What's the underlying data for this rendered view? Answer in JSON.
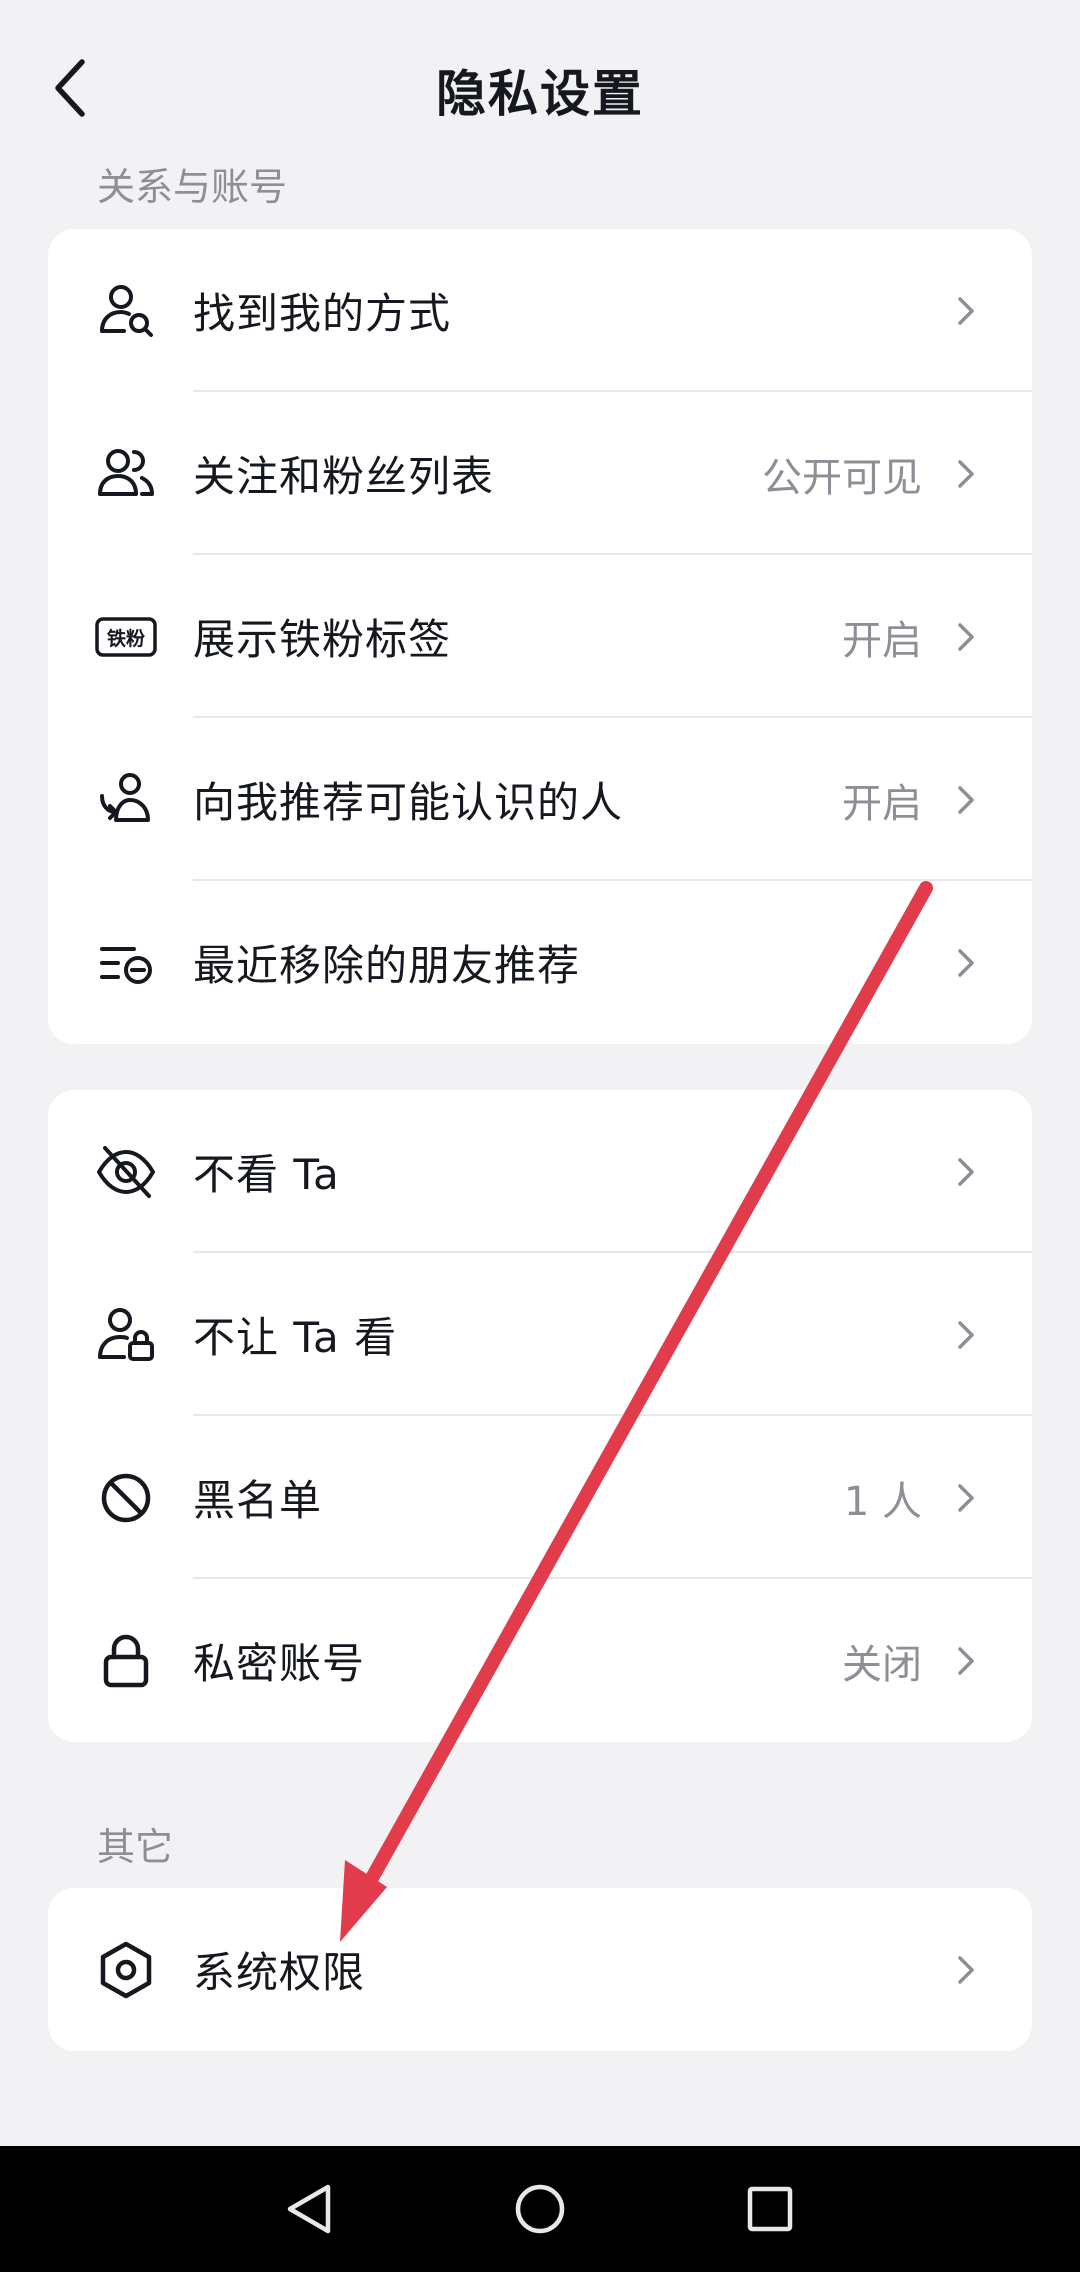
{
  "header": {
    "title": "隐私设置"
  },
  "sections": {
    "relations_label": "关系与账号",
    "other_label": "其它"
  },
  "card1": [
    {
      "label": "找到我的方式",
      "value": ""
    },
    {
      "label": "关注和粉丝列表",
      "value": "公开可见"
    },
    {
      "label": "展示铁粉标签",
      "value": "开启",
      "badge": "铁粉"
    },
    {
      "label": "向我推荐可能认识的人",
      "value": "开启"
    },
    {
      "label": "最近移除的朋友推荐",
      "value": ""
    }
  ],
  "card2": [
    {
      "label": "不看 Ta",
      "value": ""
    },
    {
      "label": "不让 Ta 看",
      "value": ""
    },
    {
      "label": "黑名单",
      "value": "1 人"
    },
    {
      "label": "私密账号",
      "value": "关闭"
    }
  ],
  "card3": [
    {
      "label": "系统权限",
      "value": ""
    }
  ],
  "colors": {
    "background": "#f2f2f4",
    "annotation_arrow": "#e23b4b",
    "secondary_text": "#8e8f96"
  }
}
